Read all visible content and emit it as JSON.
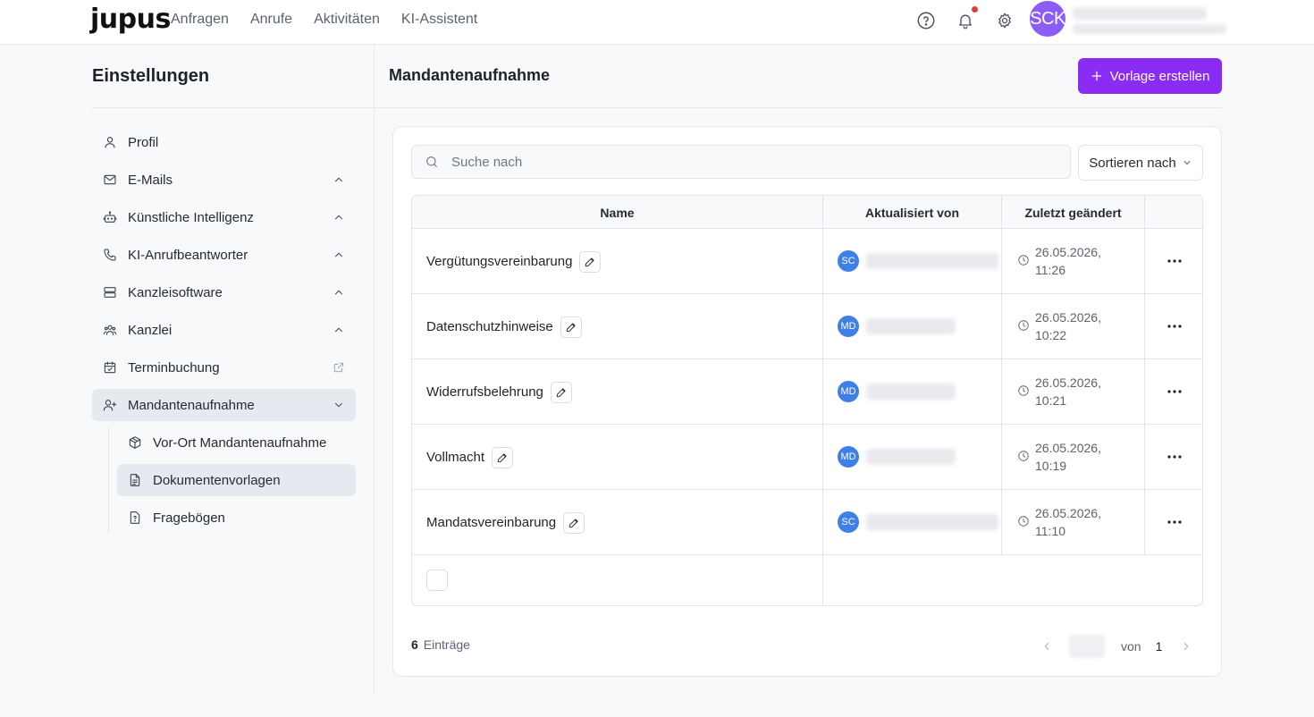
{
  "brand": {
    "logo": "jupus"
  },
  "nav": {
    "items": [
      "Anfragen",
      "Anrufe",
      "Aktivitäten",
      "KI-Assistent"
    ]
  },
  "user": {
    "initials": "SCK"
  },
  "sidebar": {
    "title": "Einstellungen",
    "items": [
      {
        "label": "Profil",
        "icon": "user-icon"
      },
      {
        "label": "E-Mails",
        "icon": "mail-icon"
      },
      {
        "label": "Künstliche Intelligenz",
        "icon": "robot-icon"
      },
      {
        "label": "KI-Anrufbeantworter",
        "icon": "phone-icon"
      },
      {
        "label": "Kanzleisoftware",
        "icon": "server-icon"
      },
      {
        "label": "Kanzlei",
        "icon": "team-icon"
      },
      {
        "label": "Terminbuchung",
        "icon": "calendar-check-icon"
      },
      {
        "label": "Mandantenaufnahme",
        "icon": "user-plus-icon"
      }
    ],
    "subitems": [
      {
        "label": "Vor-Ort Mandantenaufnahme",
        "icon": "package-icon"
      },
      {
        "label": "Dokumentenvorlagen",
        "icon": "document-icon"
      },
      {
        "label": "Fragebögen",
        "icon": "file-question-icon"
      }
    ]
  },
  "main": {
    "title": "Mandantenaufnahme",
    "create_label": "Vorlage erstellen",
    "search_placeholder": "Suche nach",
    "sort_label": "Sortieren nach"
  },
  "table": {
    "columns": [
      "Name",
      "Aktualisiert von",
      "Zuletzt geändert"
    ],
    "rows": [
      {
        "name": "Vergütungsvereinbarung",
        "initials": "SC",
        "date": "26.05.2026,",
        "time": "11:26"
      },
      {
        "name": "Datenschutzhinweise",
        "initials": "MD",
        "date": "26.05.2026,",
        "time": "10:22"
      },
      {
        "name": "Widerrufsbelehrung",
        "initials": "MD",
        "date": "26.05.2026,",
        "time": "10:21"
      },
      {
        "name": "Vollmacht",
        "initials": "MD",
        "date": "26.05.2026,",
        "time": "10:19"
      },
      {
        "name": "Mandatsvereinbarung",
        "initials": "SC",
        "date": "26.05.2026,",
        "time": "11:10"
      }
    ]
  },
  "footer": {
    "count": "6",
    "count_label": "Einträge",
    "of_label": "von",
    "total_pages": "1"
  },
  "colors": {
    "accent": "#8b2cf5",
    "avatar": "#8b5cf6",
    "mini_avatar": "#3f7fe8"
  }
}
